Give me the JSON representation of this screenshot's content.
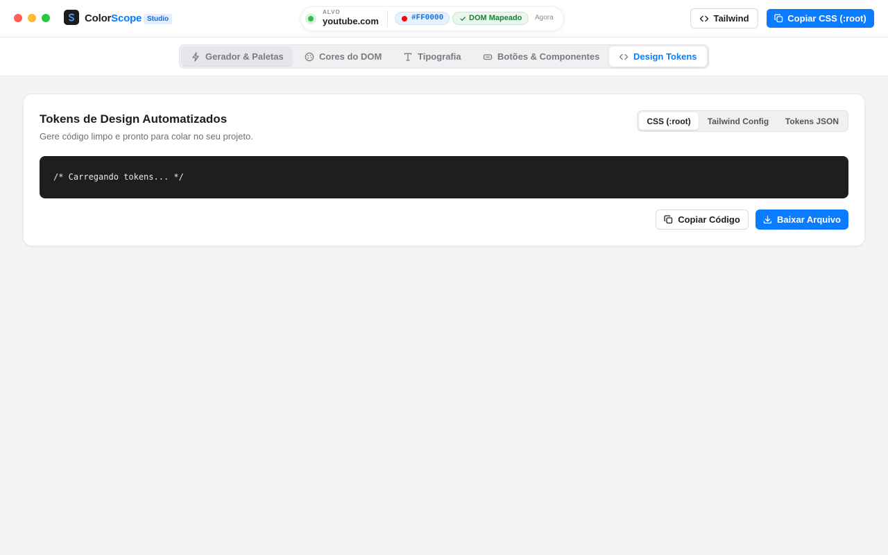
{
  "window": {
    "brand_primary": "Color",
    "brand_accent": "Scope",
    "badge": "Studio"
  },
  "target": {
    "label": "ALVO",
    "host": "youtube.com",
    "color_hex": "#FF0000",
    "dom_status": "DOM Mapeado",
    "updated": "Agora"
  },
  "header_actions": {
    "tailwind_label": "Tailwind",
    "copy_css_label": "Copiar CSS (:root)"
  },
  "tabs": [
    {
      "label": "Gerador & Paletas",
      "icon": "bolt-icon"
    },
    {
      "label": "Cores do DOM",
      "icon": "palette-icon"
    },
    {
      "label": "Tipografia",
      "icon": "type-icon"
    },
    {
      "label": "Botões & Componentes",
      "icon": "button-icon"
    },
    {
      "label": "Design Tokens",
      "icon": "code-icon",
      "active": true
    }
  ],
  "card": {
    "title": "Tokens de Design Automatizados",
    "subtitle": "Gere código limpo e pronto para colar no seu projeto.",
    "formats": [
      "CSS (:root)",
      "Tailwind Config",
      "Tokens JSON"
    ],
    "selected_format": "CSS (:root)",
    "code": "/* Carregando tokens... */",
    "copy_label": "Copiar Código",
    "download_label": "Baixar Arquivo"
  },
  "colors": {
    "accent": "#0a7cff",
    "success": "#2fbf4f",
    "code_bg": "#1e1e20",
    "page_bg": "#f3f4f6"
  }
}
